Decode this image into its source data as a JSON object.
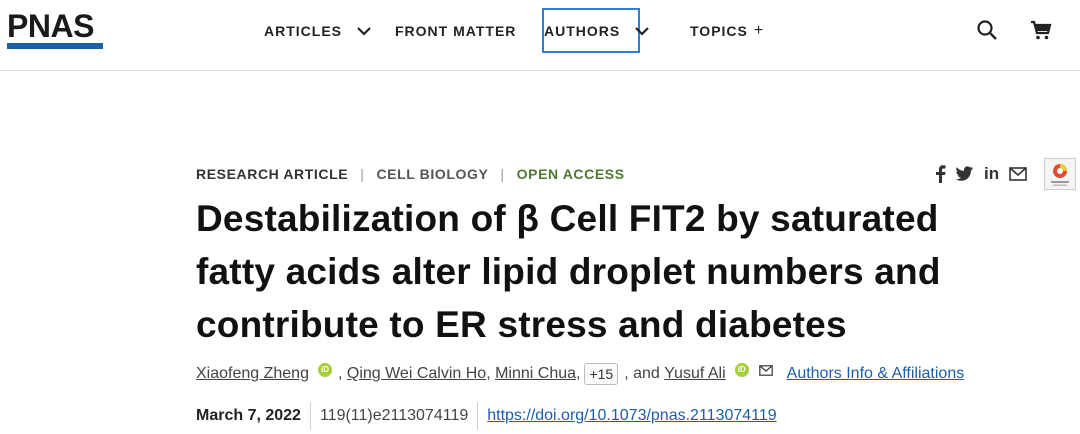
{
  "header": {
    "logo": "PNAS",
    "nav": [
      {
        "label": "ARTICLES",
        "indicator": "chevron-down"
      },
      {
        "label": "FRONT MATTER",
        "indicator": ""
      },
      {
        "label": "AUTHORS",
        "indicator": "chevron-down",
        "focused": true
      },
      {
        "label": "TOPICS",
        "indicator": "+"
      }
    ],
    "icons": [
      "search-icon",
      "cart-icon"
    ]
  },
  "article": {
    "type": "RESEARCH ARTICLE",
    "subject": "CELL BIOLOGY",
    "access": "OPEN ACCESS",
    "title": "Destabilization of β Cell FIT2 by saturated fatty acids alter lipid droplet numbers and contribute to ER stress and diabetes",
    "share_icons": [
      "facebook-icon",
      "twitter-icon",
      "linkedin-icon",
      "email-icon",
      "crossmark-icon"
    ],
    "authors": {
      "list": [
        "Xiaofeng Zheng",
        "Qing Wei Calvin Ho",
        "Minni Chua"
      ],
      "more": "+15",
      "conj": ", and",
      "last": "Yusuf Ali",
      "affiliations_link": "Authors Info & Affiliations"
    },
    "date": "March 7, 2022",
    "citation": "119(11)e2113074119",
    "doi": "https://doi.org/10.1073/pnas.2113074119"
  },
  "colors": {
    "accent": "#1a5fa8",
    "open_access": "#4d7a33",
    "focus": "#2f7bd8",
    "orcid": "#a6ce39"
  }
}
